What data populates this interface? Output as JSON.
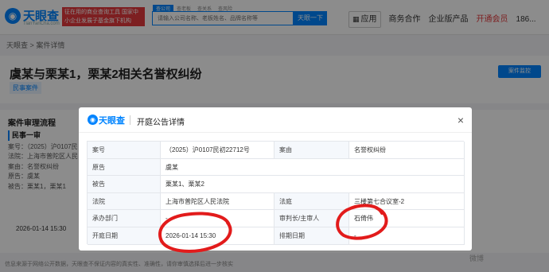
{
  "header": {
    "logo_text": "天眼查",
    "logo_sub": "TianYanCha.com",
    "promo_text": "征在用的商业查询工具 国家中小企业发展子基金旗下机构",
    "search_tabs": [
      "查公司",
      "查老板",
      "查关系",
      "查风险"
    ],
    "search_placeholder": "请输入公司名称、老板姓名、品牌名称等",
    "search_button": "天眼一下",
    "nav": {
      "app": "应用",
      "business": "商务合作",
      "products": "企业版产品",
      "vip": "开通会员",
      "user": "186..."
    }
  },
  "breadcrumb": {
    "home": "天眼查",
    "separator": ">",
    "current": "案件详情"
  },
  "case": {
    "title": "虞某与栗某1，栗某2相关名誉权纠纷",
    "tag": "民事案件",
    "monitor_button": "案件监控"
  },
  "flow": {
    "title": "案件审理流程",
    "stage": "民事一审",
    "lines": [
      "案号：（2025）沪0107民",
      "法院：上海市普陀区人民",
      "案由：名誉权纠纷",
      "原告：虞某",
      "被告：栗某1，栗某1"
    ],
    "date": "2026-01-14 15:30"
  },
  "footer": "信息来源于网络公开数据，天眼查不保证内容的真实性、准确性，请你审慎选择后进一步核实",
  "watermark": "微博",
  "modal": {
    "logo_text": "天眼查",
    "title": "开庭公告详情",
    "close_label": "×",
    "rows": [
      {
        "l1": "案号",
        "v1": "（2025）沪0107民初22712号",
        "l2": "案由",
        "v2": "名誉权纠纷"
      },
      {
        "l1": "原告",
        "v1": "虞某"
      },
      {
        "l1": "被告",
        "v1": "栗某1、栗某2"
      },
      {
        "l1": "法院",
        "v1": "上海市普陀区人民法院",
        "l2": "法庭",
        "v2": "三楼第七合议室-2"
      },
      {
        "l1": "承办部门",
        "v1": "-",
        "l2": "审判长/主审人",
        "v2": "石倚伟"
      },
      {
        "l1": "开庭日期",
        "v1": "2026-01-14 15:30",
        "l2": "排期日期",
        "v2": "-"
      }
    ]
  },
  "colors": {
    "accent": "#0084ff",
    "annotation": "#e21b1b",
    "overlay": "rgba(0,0,0,0.45)"
  }
}
